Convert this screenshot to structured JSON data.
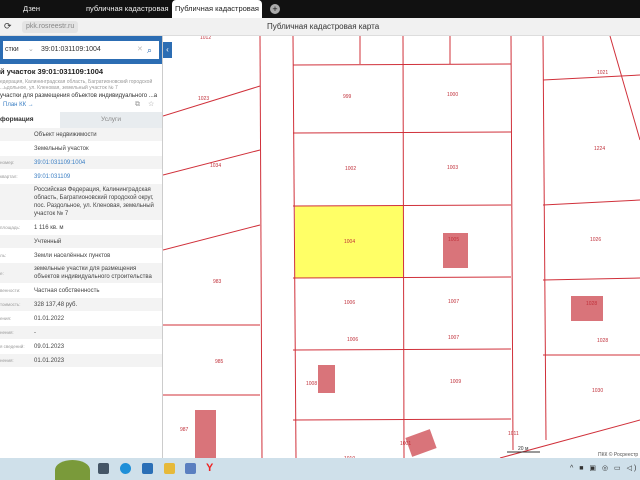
{
  "browser": {
    "tabs": [
      {
        "label": "Дзен"
      },
      {
        "label": "публичная кадастровая"
      },
      {
        "label": "Публичная кадастровая"
      }
    ],
    "url": "pkk.rosreestr.ru",
    "page_title": "Публичная кадастровая карта"
  },
  "search": {
    "category": "стки",
    "value": "39:01:031109:1004"
  },
  "parcel": {
    "title": "й участок 39:01:031109:1004",
    "address_short": "едерация, Калининградская область, Багратионовский городской ...ьдольное, ул. Кленовая, земельный участок № 7",
    "use_short": "участки для размещения объектов индивидуального ...а",
    "plan_link": "План КК →"
  },
  "tabs": {
    "info": "формация",
    "services": "Услуги"
  },
  "rows": [
    {
      "label": "",
      "value": "Объект недвижимости"
    },
    {
      "label": "",
      "value": "Земельный участок"
    },
    {
      "label": "номер:",
      "value": "39:01:031109:1004",
      "link": true
    },
    {
      "label": "квартал:",
      "value": "39:01:031109",
      "link": true
    },
    {
      "label": "",
      "value": "Российская Федерация, Калининградская область, Багратионовский городской округ, пос. Раздольное, ул. Кленовая, земельный участок № 7"
    },
    {
      "label": "площадь:",
      "value": "1 116 кв. м"
    },
    {
      "label": "",
      "value": "Учтенный"
    },
    {
      "label": "ль:",
      "value": "Земли населённых пунктов"
    },
    {
      "label": "е:",
      "value": "земельные участки для размещения объектов индивидуального строительства"
    },
    {
      "label": "венности:",
      "value": "Частная собственность"
    },
    {
      "label": "тоимость:",
      "value": "328 137,48 руб."
    },
    {
      "label": "ения:",
      "value": "01.01.2022"
    },
    {
      "label": "нения:",
      "value": "-"
    },
    {
      "label": "я сведений:",
      "value": "09.01.2023"
    },
    {
      "label": "нения:",
      "value": "01.01.2023"
    }
  ],
  "map": {
    "labels": [
      "1012",
      "1023",
      "1034",
      "999",
      "1000",
      "1021",
      "1002",
      "1003",
      "1224",
      "1004",
      "1005",
      "1026",
      "983",
      "1006",
      "1007",
      "1028",
      "985",
      "1006",
      "1007",
      "1028",
      "1008",
      "1009",
      "1030",
      "987",
      "1010",
      "1011",
      "1001"
    ],
    "scale": "20 м",
    "copyright": "ПКК © Росреестр",
    "highlight": "#ffff66",
    "line_color": "#d0303a"
  }
}
